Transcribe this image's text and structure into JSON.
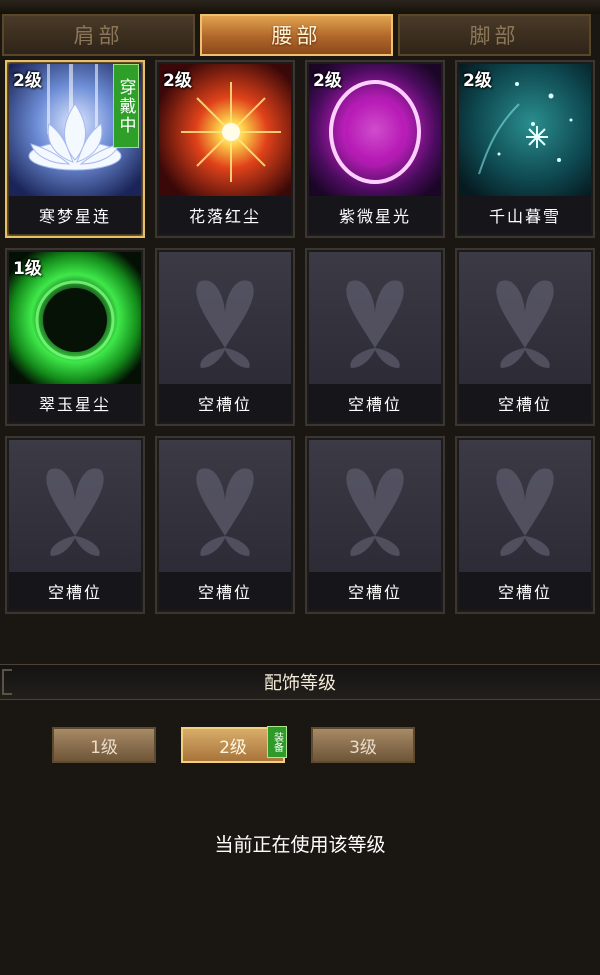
{
  "tabs": [
    {
      "label": "肩部",
      "active": false
    },
    {
      "label": "腰部",
      "active": true
    },
    {
      "label": "脚部",
      "active": false
    }
  ],
  "slots": [
    {
      "name": "寒梦星连",
      "level": "2级",
      "wearing": "穿戴中",
      "theme": "lotus"
    },
    {
      "name": "花落红尘",
      "level": "2级",
      "theme": "sunburst"
    },
    {
      "name": "紫微星光",
      "level": "2级",
      "theme": "violet-orb"
    },
    {
      "name": "千山暮雪",
      "level": "2级",
      "theme": "teal-snow"
    },
    {
      "name": "翠玉星尘",
      "level": "1级",
      "theme": "green-ring"
    },
    {
      "name": "空槽位",
      "theme": "butterfly"
    },
    {
      "name": "空槽位",
      "theme": "butterfly"
    },
    {
      "name": "空槽位",
      "theme": "butterfly"
    },
    {
      "name": "空槽位",
      "theme": "butterfly"
    },
    {
      "name": "空槽位",
      "theme": "butterfly"
    },
    {
      "name": "空槽位",
      "theme": "butterfly"
    },
    {
      "name": "空槽位",
      "theme": "butterfly"
    }
  ],
  "section_title": "配饰等级",
  "level_buttons": [
    {
      "label": "1级",
      "active": false
    },
    {
      "label": "2级",
      "active": true,
      "badge": "装备"
    },
    {
      "label": "3级",
      "active": false
    }
  ],
  "status_text": "当前正在使用该等级",
  "colors": {
    "tab_active": "#d08a3e",
    "selected_border": "#e6c16a",
    "wearing_badge": "#2ea02a"
  }
}
